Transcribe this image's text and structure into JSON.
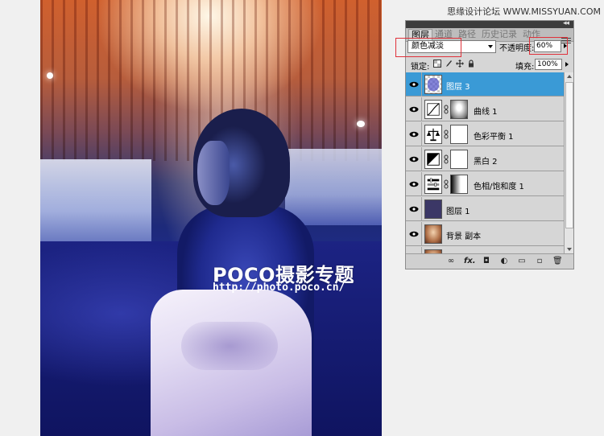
{
  "site_watermark": "思缘设计论坛 WWW.MISSYUAN.COM",
  "photo": {
    "watermark_title": "POCO摄影专题",
    "watermark_url": "http://photo.poco.cn/"
  },
  "panel": {
    "collapse_glyph": "◂◂",
    "tabs": [
      {
        "label": "图层",
        "active": true
      },
      {
        "label": "通道",
        "active": false
      },
      {
        "label": "路径",
        "active": false
      },
      {
        "label": "历史记录",
        "active": false
      },
      {
        "label": "动作",
        "active": false
      }
    ],
    "blend_mode": "颜色减淡",
    "opacity_label": "不透明度:",
    "opacity_value": "60%",
    "lock_label": "锁定:",
    "fill_label": "填充:",
    "fill_value": "100%",
    "layers": [
      {
        "name": "图层 3",
        "selected": true,
        "type": "pixel"
      },
      {
        "name": "曲线 1",
        "selected": false,
        "type": "curves"
      },
      {
        "name": "色彩平衡 1",
        "selected": false,
        "type": "color-balance"
      },
      {
        "name": "黑白 2",
        "selected": false,
        "type": "black-white"
      },
      {
        "name": "色相/饱和度 1",
        "selected": false,
        "type": "hue-saturation"
      },
      {
        "name": "图层 1",
        "selected": false,
        "type": "pixel-dark"
      },
      {
        "name": "背景 副本",
        "selected": false,
        "type": "pixel-photo"
      }
    ],
    "bottom_icons": [
      "link-icon",
      "fx-icon",
      "mask-icon",
      "adjustment-icon",
      "folder-icon",
      "new-layer-icon",
      "trash-icon"
    ],
    "bottom_labels": [
      "∞",
      "fx.",
      "◘",
      "◐",
      "▭",
      "▫",
      "🗑"
    ],
    "colors": {
      "selected_row": "#3a9ad6",
      "highlight_box": "#e0313a",
      "panel_bg": "#d6d6d6"
    }
  }
}
